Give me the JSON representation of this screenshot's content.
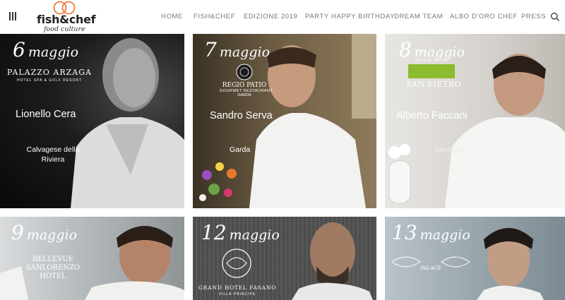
{
  "header": {
    "logo": {
      "main": "fish&chef",
      "sub": "food culture"
    },
    "nav": [
      "HOME",
      "FISH&CHEF",
      "EDIZIONE 2019",
      "PARTY HAPPY BIRTHDAY",
      "DREAM TEAM",
      "ALBO D'ORO CHEF",
      "PRESS"
    ]
  },
  "cards": [
    {
      "day": "6",
      "month": "maggio",
      "hotel": "PALAZZO ARZAGA",
      "hotel_sub": "HOTEL SPA & GOLF RESORT",
      "chef": "Lionello Cera",
      "location": "Calvagese della Riviera"
    },
    {
      "day": "7",
      "month": "maggio",
      "hotel": "REGIO PATIO",
      "hotel_sub": "GOURMET RESTAURANT",
      "hotel_sub2": "GARDA",
      "chef": "Sandro Serva",
      "location": "Garda"
    },
    {
      "day": "8",
      "month": "maggio",
      "hotel": "SAN PIETRO",
      "hotel_top": "PALACE HOTEL",
      "chef": "Alberto Faccani",
      "location": "Bardolino"
    },
    {
      "day": "9",
      "month": "maggio",
      "hotel": "BELLEVUE SANLORENZO HOTEL"
    },
    {
      "day": "12",
      "month": "maggio",
      "hotel": "GRAND HOTEL FASANO",
      "hotel_sub": "VILLA PRINCIPE"
    },
    {
      "day": "13",
      "month": "maggio",
      "hotel": "PALACE"
    }
  ],
  "colors": {
    "nav_text": "#777777",
    "card1_bg": "#111111",
    "card2_bg": "#5a4a34",
    "card3_bg": "#d9d6d2"
  }
}
